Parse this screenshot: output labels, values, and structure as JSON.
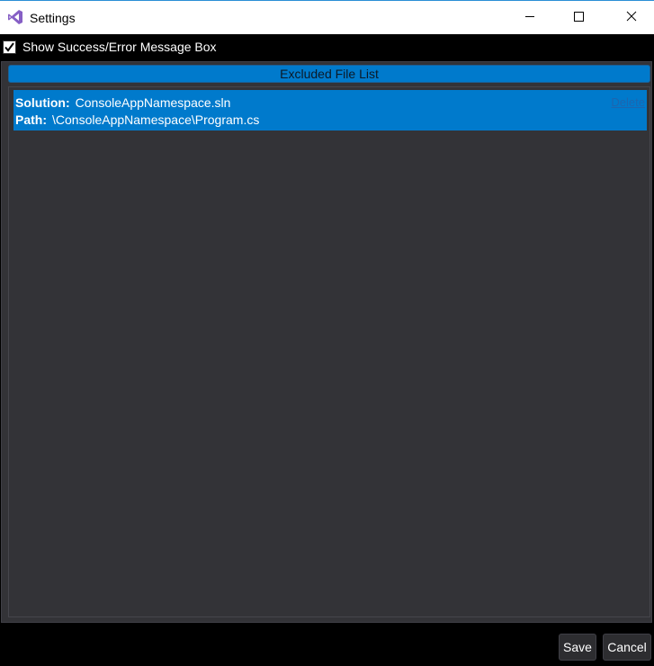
{
  "window": {
    "title": "Settings",
    "icon": "visual-studio-icon"
  },
  "controls": {
    "minimize_icon": "minimize-icon",
    "maximize_icon": "maximize-icon",
    "close_icon": "close-icon"
  },
  "options": {
    "show_message_box_label": "Show Success/Error Message Box",
    "show_message_box_checked": true
  },
  "excluded_list": {
    "header": "Excluded File List",
    "items": [
      {
        "solution_key": "Solution:",
        "solution_value": "ConsoleAppNamespace.sln",
        "path_key": "Path:",
        "path_value": "\\ConsoleAppNamespace\\Program.cs",
        "delete_label": "Delete"
      }
    ]
  },
  "footer": {
    "save_label": "Save",
    "cancel_label": "Cancel"
  },
  "colors": {
    "accent": "#007acc",
    "panel_bg": "#333337",
    "window_bg": "#000000",
    "icon_purple": "#865fc5"
  }
}
